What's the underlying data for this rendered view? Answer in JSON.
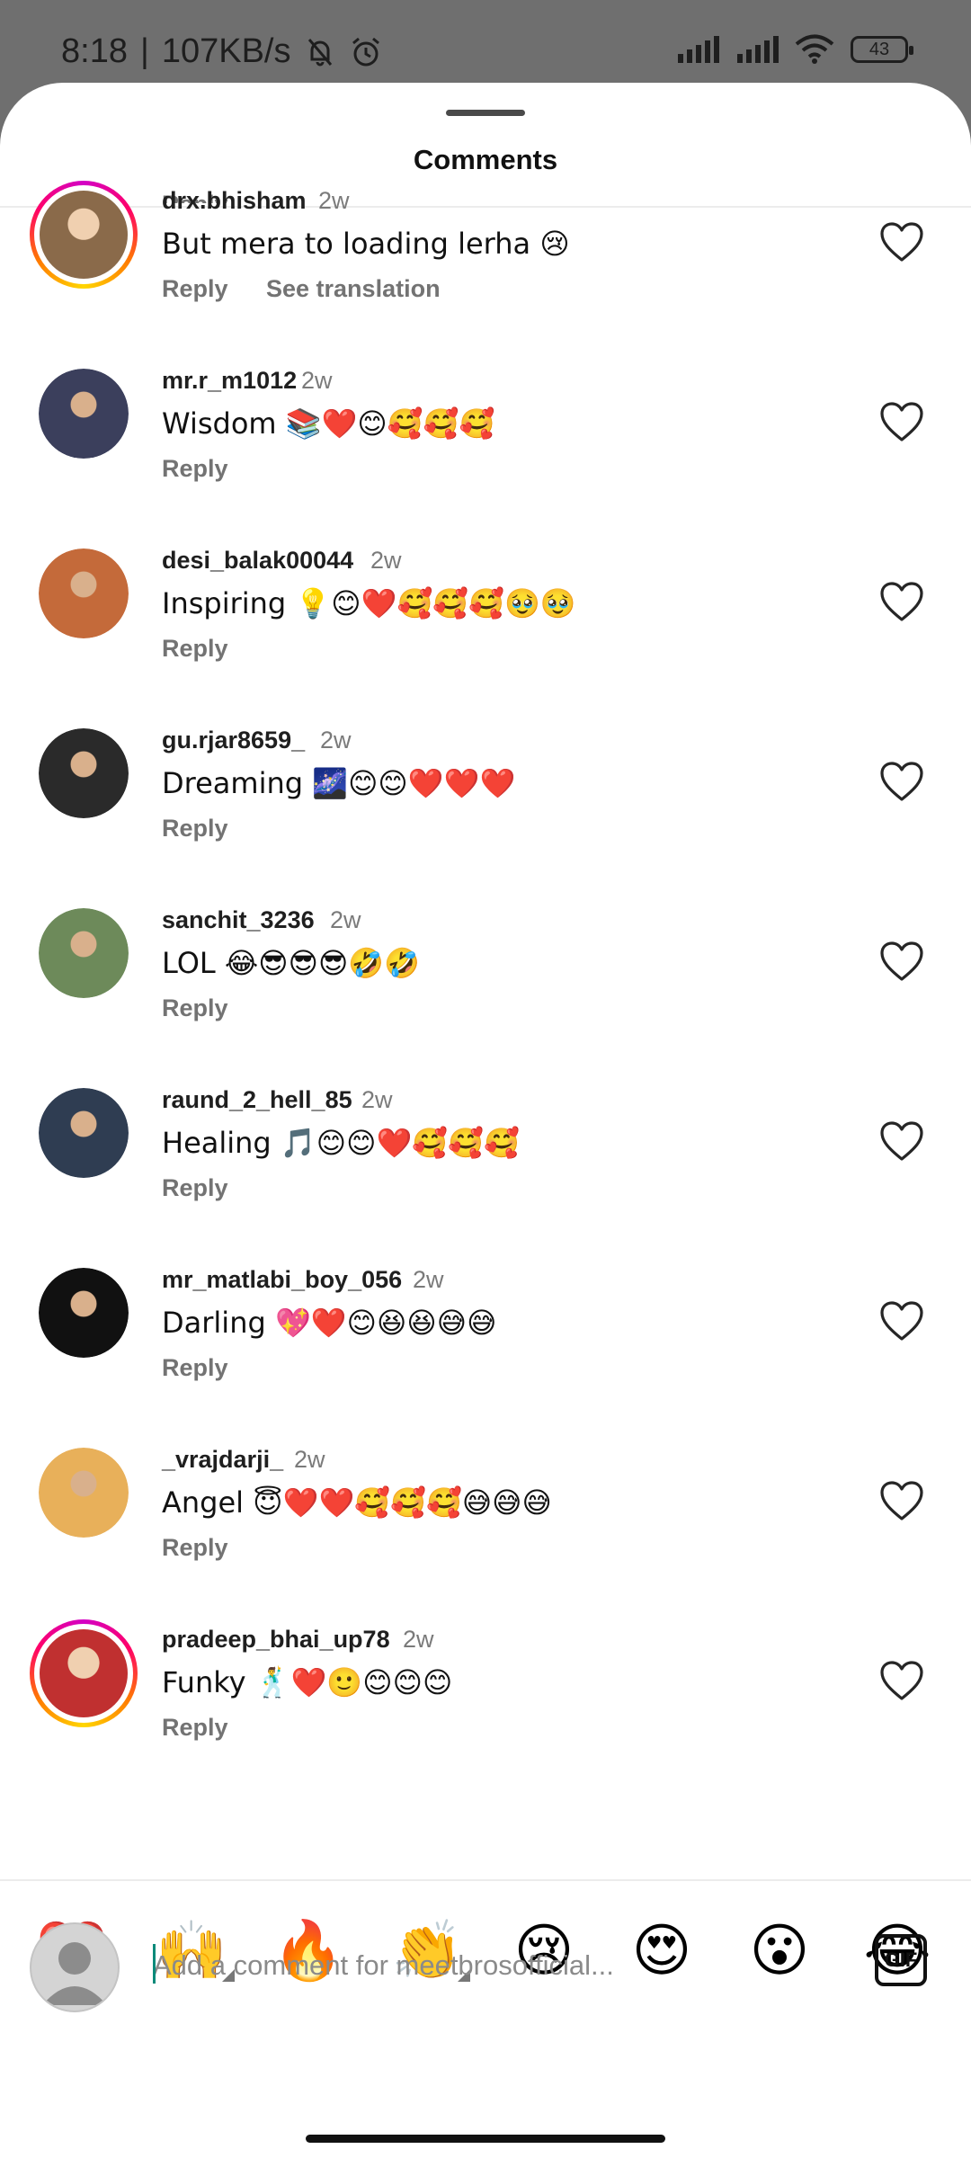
{
  "status_bar": {
    "time": "8:18",
    "separator": "|",
    "speed": "107KB/s",
    "battery": "43"
  },
  "sheet": {
    "title": "Comments",
    "partial_reply": "Reply"
  },
  "comments": [
    {
      "username": "drx.bhisham",
      "time": "2w",
      "text": "But mera to loading lerha 😢",
      "reply": "Reply",
      "translate": "See translation",
      "ring": true,
      "avatar_color": "#8a6a4a"
    },
    {
      "username": "mr.r_m1012",
      "time": "2w",
      "text": "Wisdom 📚❤️😊🥰🥰🥰",
      "reply": "Reply",
      "ring": false,
      "avatar_color": "#3b3f5c"
    },
    {
      "username": "desi_balak00044",
      "time": "2w",
      "text": "Inspiring 💡😊❤️🥰🥰🥰🥹🥹",
      "reply": "Reply",
      "ring": false,
      "avatar_color": "#c46a3a"
    },
    {
      "username": "gu.rjar8659_",
      "time": "2w",
      "text": "Dreaming 🌌😊😊❤️❤️❤️",
      "reply": "Reply",
      "ring": false,
      "avatar_color": "#2a2a2a"
    },
    {
      "username": "sanchit_3236",
      "time": "2w",
      "text": "LOL 😂😎😎😎🤣🤣",
      "reply": "Reply",
      "ring": false,
      "avatar_color": "#6d8a5a"
    },
    {
      "username": "raund_2_hell_85",
      "time": "2w",
      "text": "Healing 🎵😊😊❤️🥰🥰🥰",
      "reply": "Reply",
      "ring": false,
      "avatar_color": "#2f3d52"
    },
    {
      "username": "mr_matlabi_boy_056",
      "time": "2w",
      "text": "Darling 💖❤️😊😆😆😅😅",
      "reply": "Reply",
      "ring": false,
      "avatar_color": "#111111"
    },
    {
      "username": "_vrajdarji_",
      "time": "2w",
      "text": "Angel 😇❤️❤️🥰🥰🥰😅😅😅",
      "reply": "Reply",
      "ring": false,
      "avatar_color": "#e8b05a"
    },
    {
      "username": "pradeep_bhai_up78",
      "time": "2w",
      "text": "Funky 🕺❤️🙂😊😊😊",
      "reply": "Reply",
      "ring": true,
      "avatar_color": "#c03030"
    }
  ],
  "emoji_bar": [
    "❤️",
    "🙌",
    "🔥",
    "👏",
    "😢",
    "😍",
    "😮",
    "😂"
  ],
  "composer": {
    "placeholder": "Add a comment for meetbrosofficial...",
    "gif_label": "GIF"
  },
  "colors": {
    "heart_outline": "#262626",
    "meta_gray": "#737373",
    "ring_start": "#d300c5",
    "ring_end": "#ffd600"
  }
}
